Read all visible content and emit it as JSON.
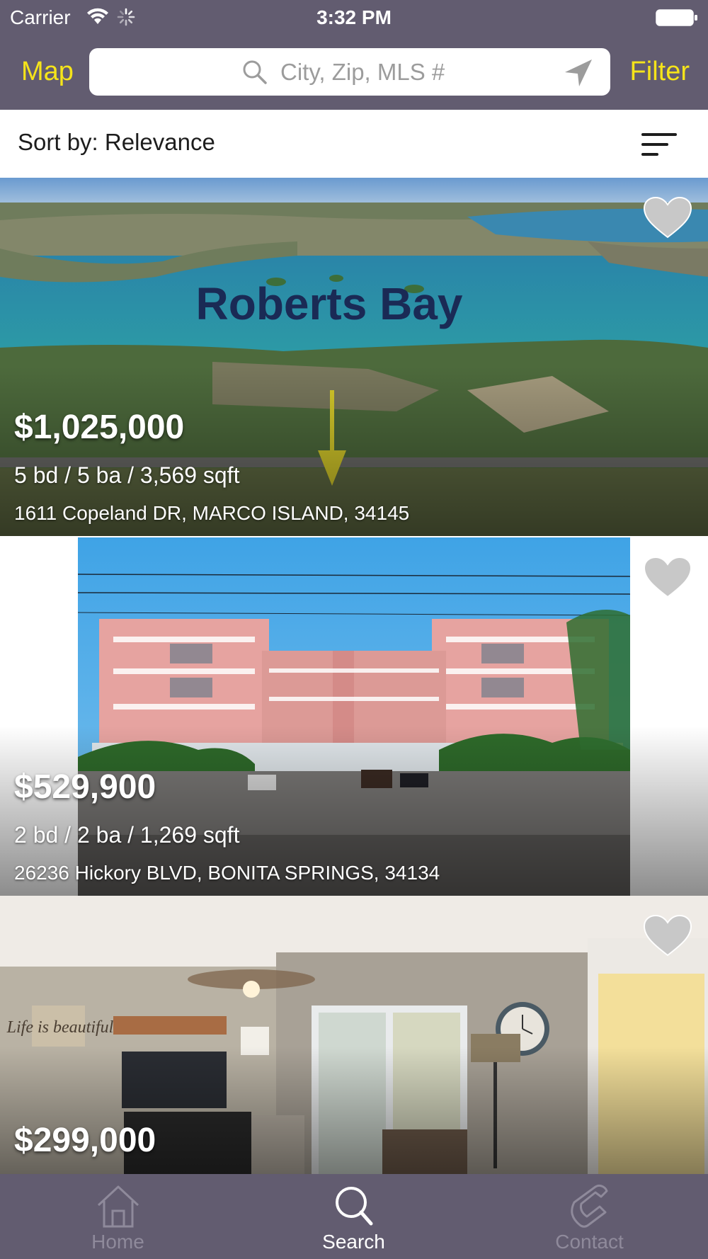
{
  "status_bar": {
    "carrier": "Carrier",
    "time": "3:32 PM"
  },
  "nav": {
    "map_label": "Map",
    "filter_label": "Filter",
    "search_placeholder": "City, Zip, MLS #"
  },
  "sort": {
    "label": "Sort by: Relevance"
  },
  "listings": [
    {
      "price": "$1,025,000",
      "specs": "5 bd / 5 ba / 3,569 sqft",
      "address": "1611 Copeland DR, MARCO ISLAND, 34145",
      "photo_overlay_text": "Roberts Bay"
    },
    {
      "price": "$529,900",
      "specs": "2 bd / 2 ba / 1,269 sqft",
      "address": "26236 Hickory BLVD, BONITA SPRINGS, 34134"
    },
    {
      "price": "$299,000",
      "photo_sign_text": "Life is beautiful"
    }
  ],
  "tabs": [
    {
      "label": "Home",
      "icon": "home-icon",
      "active": false
    },
    {
      "label": "Search",
      "icon": "search-icon",
      "active": true
    },
    {
      "label": "Contact",
      "icon": "phone-icon",
      "active": false
    }
  ],
  "colors": {
    "bar_background": "#625c70",
    "accent_yellow": "#f5e41a",
    "tab_inactive": "#8f8a9b",
    "tab_active": "#ffffff"
  }
}
